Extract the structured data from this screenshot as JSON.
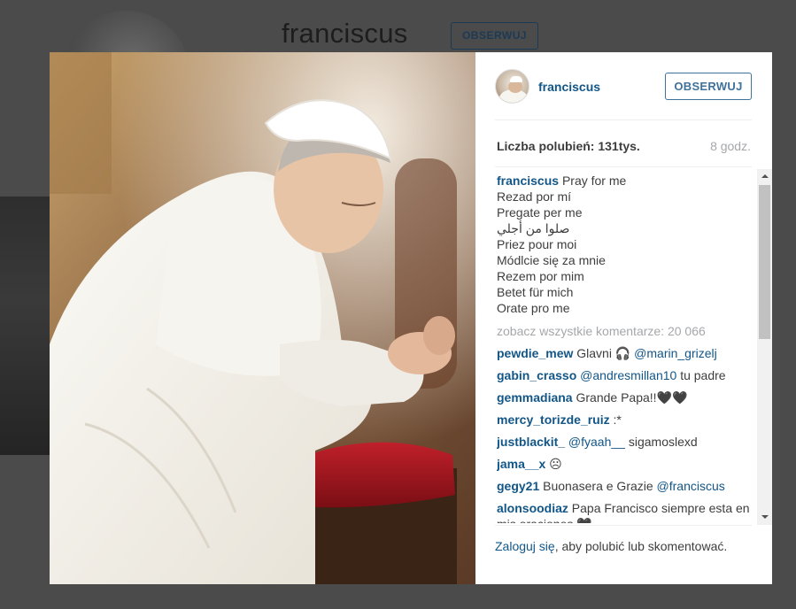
{
  "background": {
    "username": "franciscus",
    "follow_label": "OBSERWUJ"
  },
  "post": {
    "username": "franciscus",
    "follow_label": "OBSERWUJ",
    "likes": "Liczba polubień: 131tys.",
    "time": "8 godz.",
    "caption_user": "franciscus",
    "caption_lines": [
      "Pray for me",
      "Rezad por mí",
      "Pregate per me",
      "صلوا من أجلي",
      "Priez pour moi",
      "Módlcie się za mnie",
      "Rezem por mim",
      "Betet für mich",
      "Orate pro me"
    ],
    "view_all": "zobacz wszystkie komentarze: 20 066",
    "comments": [
      {
        "user": "pewdie_mew",
        "text": "Glavni 🎧 ",
        "mention": "@marin_grizelj",
        "after": ""
      },
      {
        "user": "gabin_crasso",
        "text": "",
        "mention": "@andresmillan10",
        "after": " tu padre"
      },
      {
        "user": "gemmadiana",
        "text": "Grande Papa!!🖤🖤",
        "mention": "",
        "after": ""
      },
      {
        "user": "mercy_torizde_ruiz",
        "text": ":*",
        "mention": "",
        "after": ""
      },
      {
        "user": "justblackit_",
        "text": "",
        "mention": "@fyaah__",
        "after": " sigamoslexd"
      },
      {
        "user": "jama__x",
        "text": "☹",
        "mention": "",
        "after": ""
      },
      {
        "user": "gegy21",
        "text": "Buonasera e Grazie ",
        "mention": "@franciscus",
        "after": ""
      },
      {
        "user": "alonsoodiaz",
        "text": "Papa Francisco siempre esta en mis oraciones 🖤",
        "mention": "",
        "after": ""
      }
    ],
    "footer_login": "Zaloguj się",
    "footer_rest": ", aby polubić lub skomentować."
  },
  "colors": {
    "link": "#125688",
    "button": "#3f729b",
    "overlay": "#4b4b4b"
  }
}
